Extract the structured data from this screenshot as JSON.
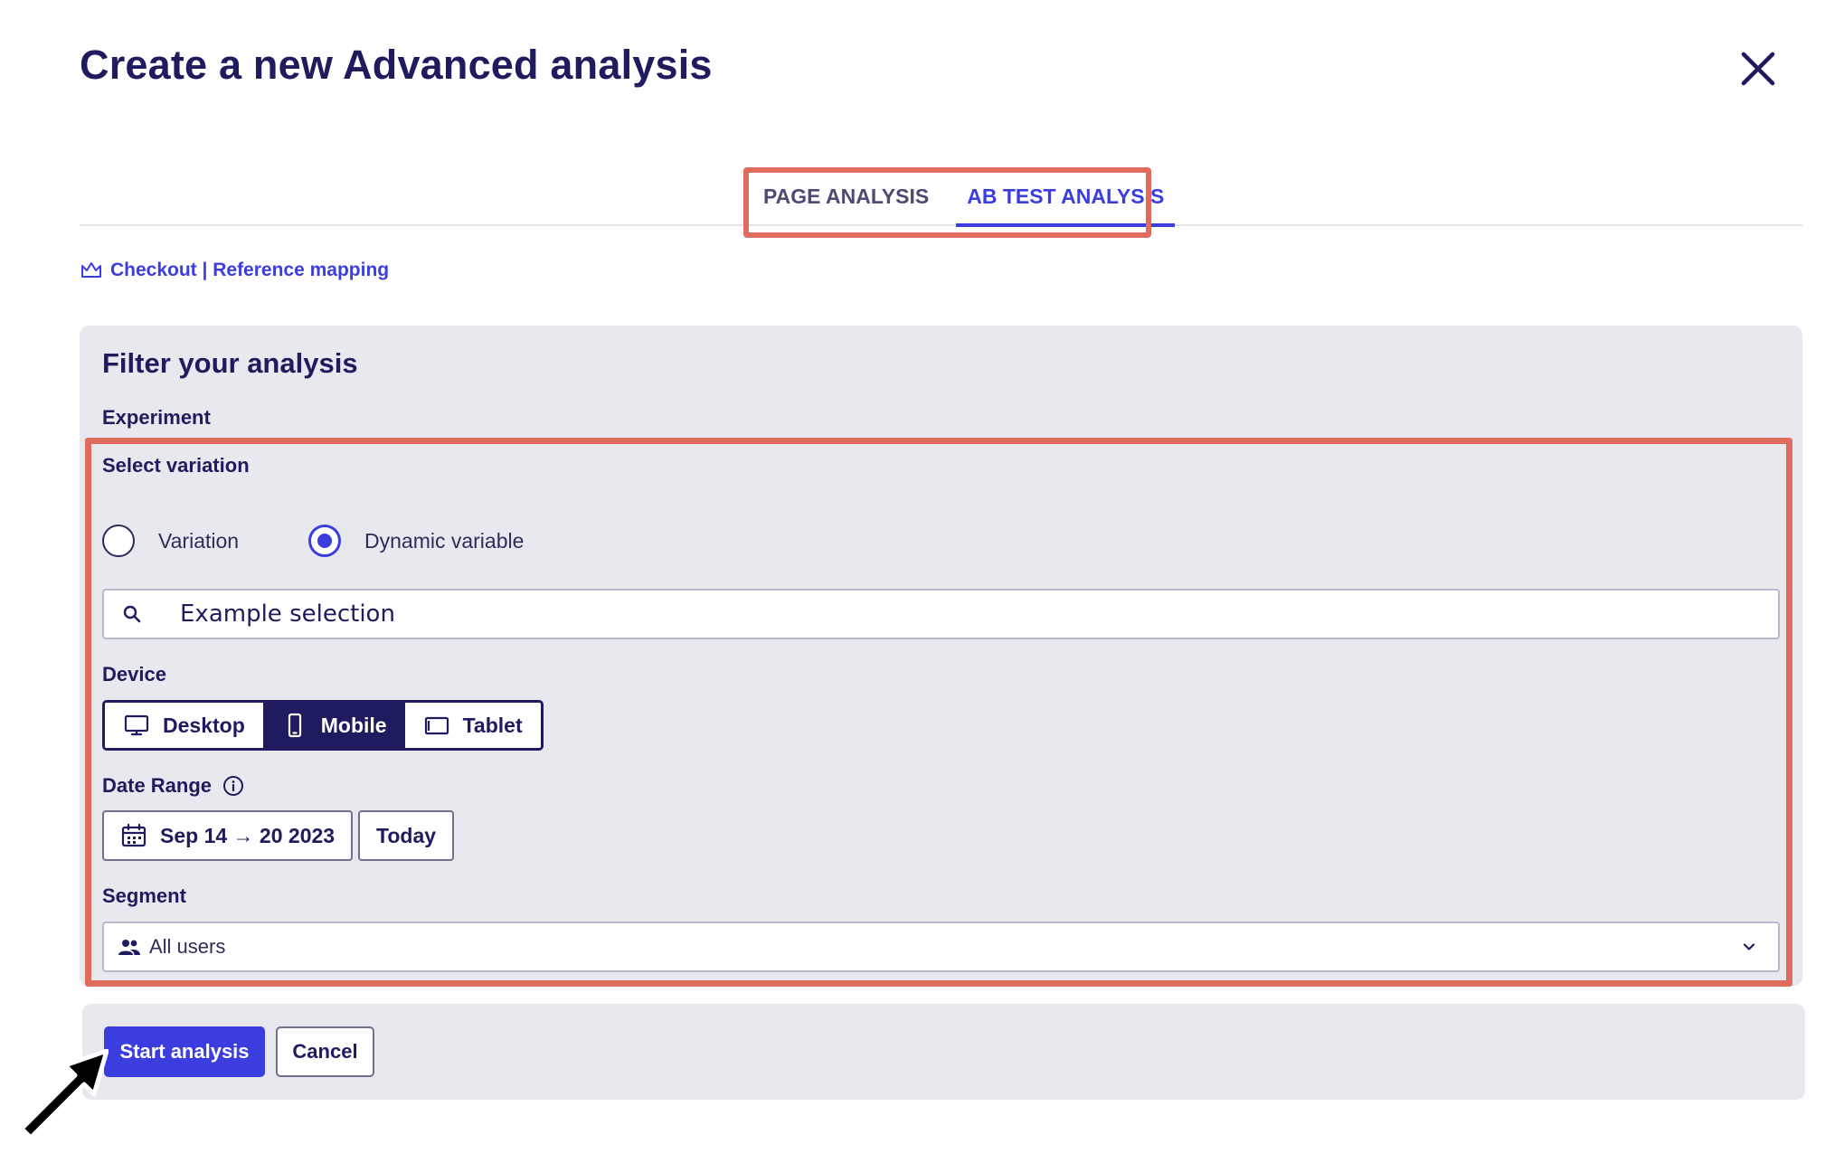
{
  "dialog": {
    "title": "Create a new Advanced analysis"
  },
  "tabs": [
    {
      "label": "PAGE ANALYSIS",
      "active": false
    },
    {
      "label": "AB TEST ANALYSIS",
      "active": true
    }
  ],
  "breadcrumb": {
    "text": "Checkout | Reference mapping",
    "icon": "crown-icon"
  },
  "filter": {
    "heading": "Filter your analysis",
    "experiment_label": "Experiment",
    "select_variation_label": "Select variation",
    "radio_options": [
      {
        "label": "Variation",
        "checked": false
      },
      {
        "label": "Dynamic variable",
        "checked": true
      }
    ],
    "search": {
      "value": "",
      "placeholder": "Example selection"
    },
    "device_label": "Device",
    "devices": [
      {
        "label": "Desktop",
        "icon": "desktop-icon",
        "active": false
      },
      {
        "label": "Mobile",
        "icon": "mobile-icon",
        "active": true
      },
      {
        "label": "Tablet",
        "icon": "tablet-icon",
        "active": false
      }
    ],
    "date_range_label": "Date Range",
    "date_range_value": "Sep 14 → 20 2023",
    "today_label": "Today",
    "segment_label": "Segment",
    "segment_value": "All users"
  },
  "footer": {
    "start_label": "Start analysis",
    "cancel_label": "Cancel"
  },
  "colors": {
    "accent": "#3b3ddf",
    "navy": "#1e1b5e",
    "highlight": "#e06b5f",
    "panel": "#e7e9ef"
  }
}
